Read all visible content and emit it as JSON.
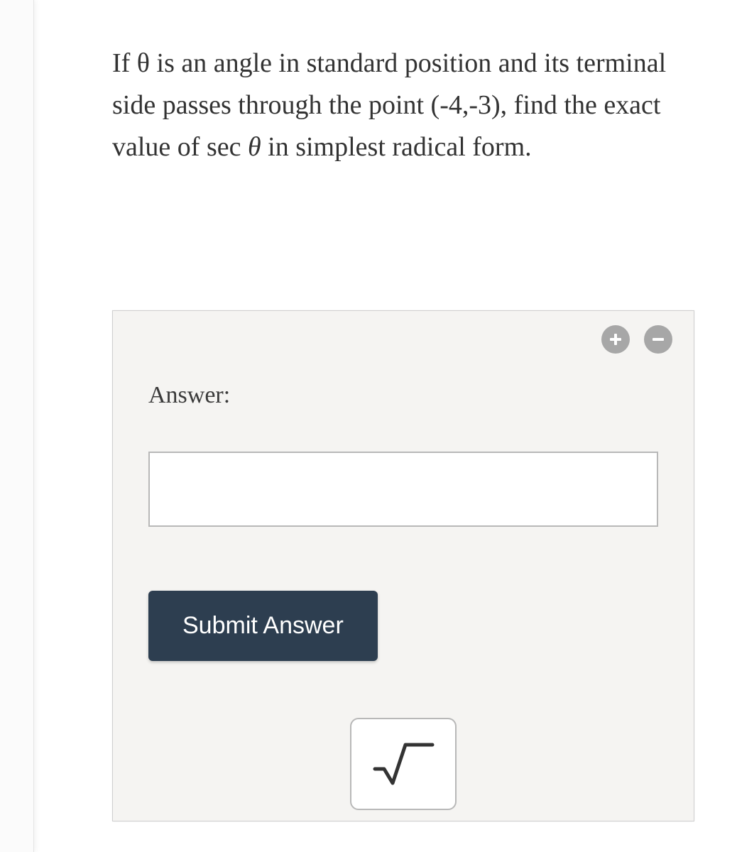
{
  "question": {
    "prefix": "If θ is an angle in standard position and its terminal side passes through the point (-4,-3), find the exact value of ",
    "func": "sec",
    "var": "θ",
    "suffix": " in simplest radical form."
  },
  "panel": {
    "answer_label": "Answer:",
    "input_value": "",
    "submit_label": "Submit Answer"
  },
  "icons": {
    "plus": "plus-icon",
    "minus": "minus-icon",
    "sqrt": "sqrt-icon"
  }
}
